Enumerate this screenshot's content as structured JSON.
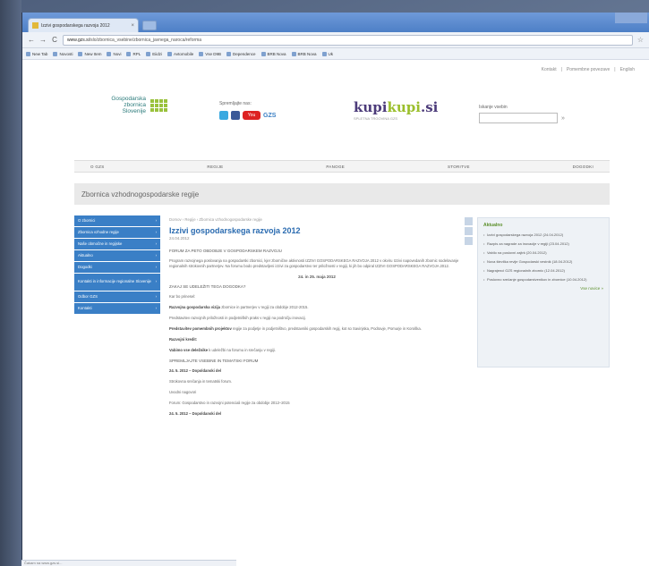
{
  "tab": {
    "title": "Izzivi gospodarskega razvoja 2012",
    "close": "×"
  },
  "toolbar": {
    "back": "←",
    "forward": "→",
    "reload": "C",
    "url_domain": "www.gzs.si",
    "url_path": "/slo/zbornica_vsebine/zbornica_javnega_naroca/reforma",
    "bookmark_star": "☆"
  },
  "bookmarks": [
    "New Tab",
    "Novosti",
    "New Item",
    "Novi",
    "RPL",
    "Eiidzi",
    "Avtomobile",
    "Vse D9B",
    "Dependence",
    "BRB Nova",
    "BRB Nova",
    "Uk"
  ],
  "toplinks": [
    "Kontakt",
    "|",
    "Pomembne povezave",
    "|",
    "English"
  ],
  "logo": {
    "line1": "Gospodarska",
    "line2": "zbornica",
    "line3": "Slovenije"
  },
  "follow": {
    "label": "Spremljajte nas:",
    "yt": "You",
    "gzs": "GZS"
  },
  "kupi": {
    "brand_a": "kupi",
    "brand_b": "kupi",
    "brand_c": ".si",
    "sub": "SPLETNA TRGOVINA GZS"
  },
  "search": {
    "label": "Iskanje vsebin",
    "go": "»"
  },
  "mainnav": [
    "O GZS",
    "REGIJE",
    "PANOGE",
    "STORITVE",
    "DOGODKI"
  ],
  "page_heading": "Zbornica vzhodnogospodarske regije",
  "sidenav": [
    "O zbornici",
    "Zbornica vzhodne regije",
    "Naše območne in regijske",
    "Aktualno",
    "Dogodki",
    "Kontakti in informacije regionalne Slovenije",
    "Odbor GZS",
    "Kontakti"
  ],
  "article": {
    "breadcrumb": "Domov › Regije › Zbornica vzhodnogospodarske regije",
    "title": "Izzivi gospodarskega razvoja 2012",
    "date": "24.04.2012",
    "section1": "FORUM ZA PETO OBDOBJE V GOSPODARSKEM RAZVOJU",
    "para1": "Program razvojnega poslovanja na gospodarski zbornici, kjer zbornične aktivnosti IZZIVI GOSPODARSKEGA RAZVOJA 2012 v okviru Izzivi napovedanih zbornic sodelovanje regionalnih strokovnih partnerjev. Na forumu bodo predstavljeni izzivi za gospodarstvo ter priložnosti v regiji, ki jih bo odpiral IZZIVI GOSPODARSKEGA RAZVOJA 2012.",
    "date_line": "24. in 25. maja 2012",
    "section2": "ZAKAJ SE UDELEŽITI TEGA DOGODKA?",
    "for_who": "Kar bo prinesel:",
    "li1_b": "Razvojna gospodarska vizija",
    "li1": " zbornice in partnerjev v regiji za obdobje 2012-2015.",
    "li2": "Predstavitev razvojnih priložnosti in podjetniških praks v regiji na področju inovacij.",
    "li3_b": "Predstavitev pomembnih projektov",
    "li3": " regije za podjetje in podjetništvo, predstavniki gospodarskih regij, kot so Savinjska, Podravje, Pomurje in Koroška.",
    "li4_b": "Razvojni kredit:",
    "li5_b": "Vabimo vse deležnike",
    "li5": " k udeležbi na forumu in srečanju v regiji.",
    "section3": "SPREMLJAJTE VSEBINE IN TEMATSKI FORUM",
    "d1": "24. 5. 2012 – Dopoldanski del",
    "d1a": "Strokovna srečanja in tematski forum.",
    "d1b": "Uvodni nagovori",
    "d1c": "Forum: Gospodarstvo in razvojni potenciali regije za obdobje 2012–2015",
    "d2": "24. 5. 2012 – Dopoldanski del"
  },
  "sidebar": {
    "heading": "Aktualno",
    "items": [
      "Izzivi gospodarskega razvoja 2012 (24.04.2012)",
      "Razpis za nagrade za inovacije v regiji (23.04.2012)",
      "Vabilo na poslovni zajtrk (20.04.2012)",
      "Nova številka revije Gospodarski vestnik (18.04.2012)",
      "Nagrajenci GZS regionalnih zbornic (12.04.2012)",
      "Poslovno srečanje gospodarstvenikov in zbornice (10.04.2012)"
    ],
    "more": "Vse novice »"
  },
  "status": "Čakam na www.gzs.si..."
}
